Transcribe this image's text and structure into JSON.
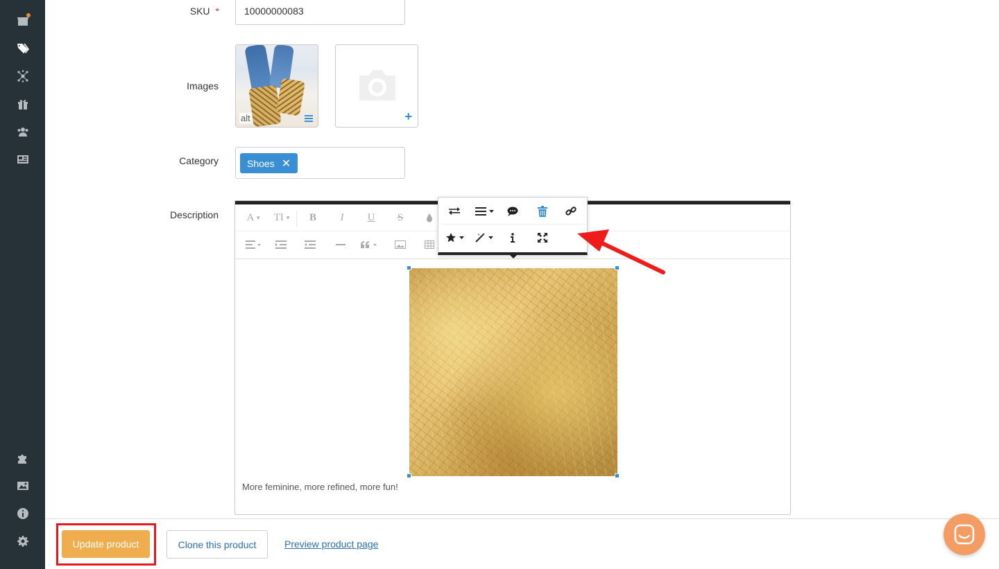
{
  "sidebar": {
    "items": [
      {
        "icon": "store-icon",
        "notification": true
      },
      {
        "icon": "tags-icon",
        "active": true
      },
      {
        "icon": "network-icon"
      },
      {
        "icon": "gift-icon"
      },
      {
        "icon": "users-icon"
      },
      {
        "icon": "news-icon"
      },
      {
        "icon": "puzzle-icon"
      },
      {
        "icon": "image-icon"
      },
      {
        "icon": "info-icon"
      },
      {
        "icon": "gear-icon"
      }
    ]
  },
  "form": {
    "sku_label": "SKU",
    "sku_required": "*",
    "sku_value": "10000000083",
    "images_label": "Images",
    "image_alt": "alt",
    "category_label": "Category",
    "category_tag": "Shoes",
    "category_tag_remove": "✕",
    "description_label": "Description"
  },
  "editor": {
    "toolbar_row1": [
      "A",
      "TI",
      "B",
      "I",
      "U",
      "S"
    ],
    "description_text": "More feminine, more refined, more fun!",
    "image_popover_buttons": [
      "swap-icon",
      "align-icon",
      "comment-icon",
      "trash-icon",
      "link-icon",
      "star-icon",
      "magic-wand-icon",
      "info-icon",
      "expand-icon"
    ]
  },
  "footer": {
    "update_label": "Update product",
    "clone_label": "Clone this product",
    "preview_label": "Preview product page"
  },
  "colors": {
    "sidebar_bg": "#263238",
    "accent_blue": "#3a8fd4",
    "update_btn": "#f0ad4e",
    "highlight_red": "#e5161c",
    "chat_bubble": "#f39c63"
  }
}
